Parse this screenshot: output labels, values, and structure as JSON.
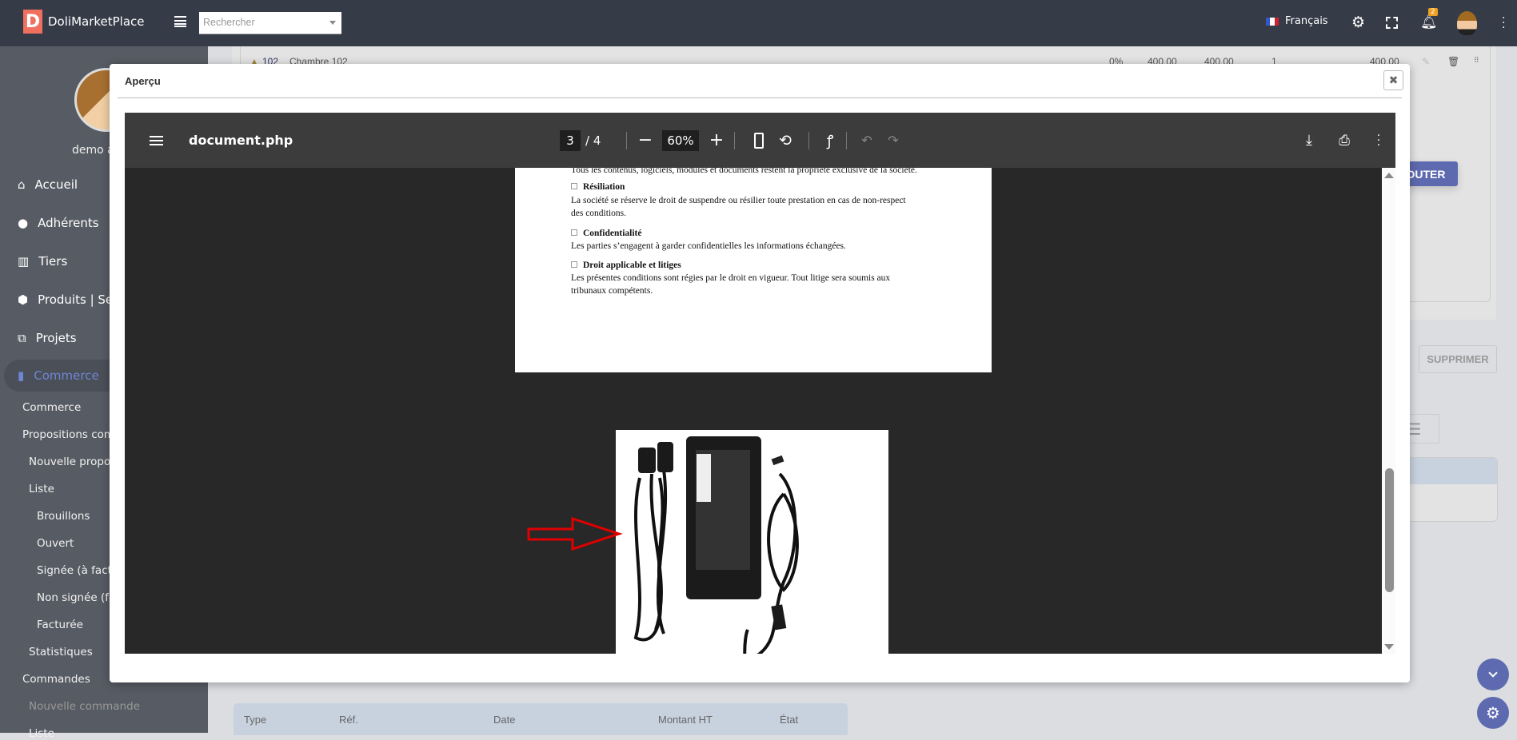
{
  "header": {
    "logo_letter": "D",
    "app_name": "DoliMarketPlace",
    "search_placeholder": "Rechercher",
    "language": "Français",
    "notification_count": "2"
  },
  "sidebar": {
    "user_name": "demo admin",
    "items": [
      {
        "label": "Accueil"
      },
      {
        "label": "Adhérents"
      },
      {
        "label": "Tiers"
      },
      {
        "label": "Produits | Services"
      },
      {
        "label": "Projets"
      },
      {
        "label": "Commerce"
      }
    ],
    "subitems": [
      {
        "label": "Commerce"
      },
      {
        "label": "Propositions commerciales"
      },
      {
        "label": "Nouvelle proposition"
      },
      {
        "label": "Liste"
      },
      {
        "label": "Brouillons"
      },
      {
        "label": "Ouvert"
      },
      {
        "label": "Signée (à facturer)"
      },
      {
        "label": "Non signée (fermée)"
      },
      {
        "label": "Facturée"
      },
      {
        "label": "Statistiques"
      },
      {
        "label": "Commandes"
      },
      {
        "label": "Nouvelle commande"
      },
      {
        "label": "Liste"
      }
    ]
  },
  "background": {
    "line": {
      "ref": "102",
      "label": "Chambre 102",
      "discount": "0%",
      "pu_ht": "400,00",
      "pu_ttc": "400,00",
      "qty": "1",
      "total": "400,00"
    },
    "add_button": "AJOUTER",
    "delete_button": "SUPPRIMER",
    "table_headers": [
      "Type",
      "Réf.",
      "Date",
      "Montant HT",
      "État"
    ]
  },
  "modal": {
    "title": "Aperçu",
    "viewer": {
      "filename": "document.php",
      "current_page": "3",
      "total_pages": "/ 4",
      "zoom": "60%",
      "content": {
        "top_line": "Tous les contenus, logiciels, modules et documents restent la propriété exclusive de la société.",
        "sections": [
          {
            "heading": "Résiliation",
            "lines": [
              "La société se réserve le droit de suspendre ou résilier toute prestation en cas de non-respect",
              "des conditions."
            ]
          },
          {
            "heading": "Confidentialité",
            "lines": [
              "Les parties s’engagent à garder confidentielles les informations échangées."
            ]
          },
          {
            "heading": "Droit applicable et litiges",
            "lines": [
              "Les présentes conditions sont régies par le droit en vigueur. Tout litige sera soumis aux",
              "tribunaux compétents."
            ]
          }
        ]
      }
    }
  },
  "colors": {
    "topbar": "#363b48",
    "sidebar": "#575b63",
    "accent": "#5e6ab0",
    "arrow": "#e00000"
  }
}
